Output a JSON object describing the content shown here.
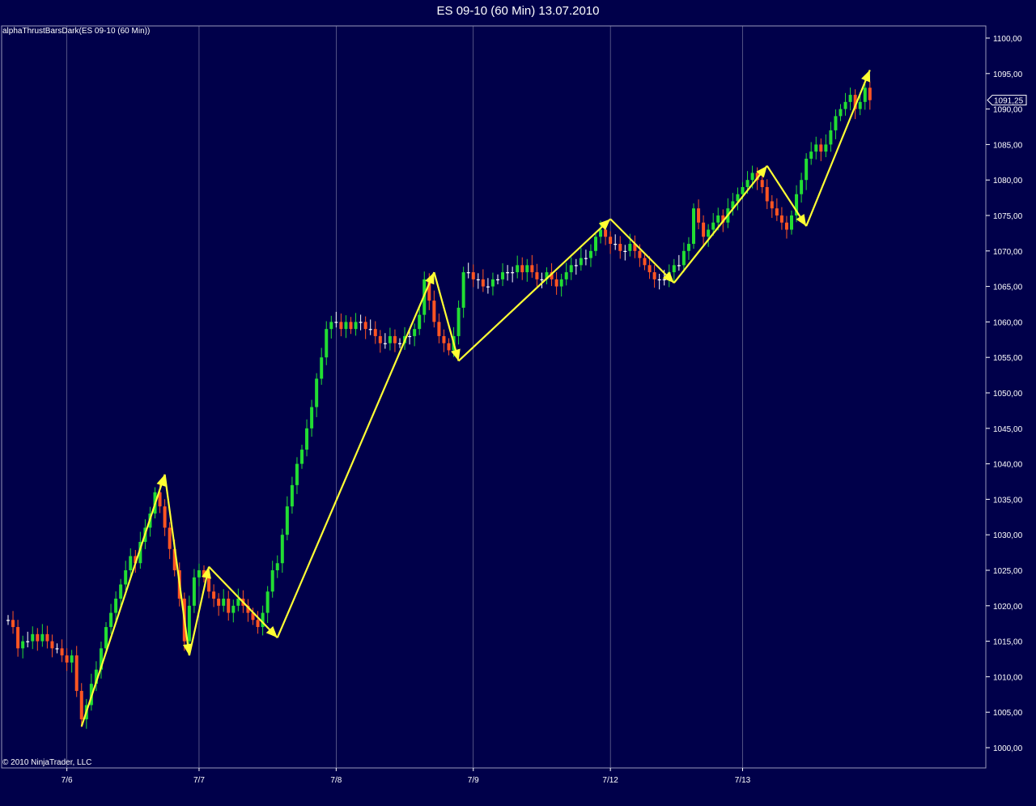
{
  "window": {
    "title": "ES 09-10 (60 Min)  13.07.2010",
    "indicator_label": "alphaThrustBarsDark(ES 09-10 (60 Min))",
    "copyright": "© 2010 NinjaTrader, LLC"
  },
  "colors": {
    "background": "#00004a",
    "grid": "#8888aa",
    "up_candle": "#22dd33",
    "down_candle": "#ff5522",
    "doji": "#ffffff",
    "zigzag": "#ffff33",
    "text": "#ffffff"
  },
  "chart_data": {
    "type": "candlestick",
    "title": "ES 09-10 (60 Min)  13.07.2010",
    "xlabel": "",
    "ylabel": "",
    "ylim": [
      998,
      1102
    ],
    "y_ticks": [
      1000,
      1005,
      1010,
      1015,
      1020,
      1025,
      1030,
      1035,
      1040,
      1045,
      1050,
      1055,
      1060,
      1065,
      1070,
      1075,
      1080,
      1085,
      1090,
      1095,
      1100
    ],
    "y_tick_labels": [
      "1000,00",
      "1005,00",
      "1010,00",
      "1015,00",
      "1020,00",
      "1025,00",
      "1030,00",
      "1035,00",
      "1040,00",
      "1045,00",
      "1050,00",
      "1055,00",
      "1060,00",
      "1065,00",
      "1070,00",
      "1075,00",
      "1080,00",
      "1085,00",
      "1090,00",
      "1095,00",
      "1100,00"
    ],
    "x_ticks": [
      {
        "label": "7/6",
        "bar": 12
      },
      {
        "label": "7/7",
        "bar": 39
      },
      {
        "label": "7/8",
        "bar": 67
      },
      {
        "label": "7/9",
        "bar": 95
      },
      {
        "label": "7/12",
        "bar": 123
      },
      {
        "label": "7/13",
        "bar": 150
      }
    ],
    "last_price": 1091.25,
    "last_price_label": "1091,25",
    "grid": "vertical-session-lines",
    "legend": "none",
    "closes": [
      1018,
      1017,
      1014,
      1015,
      1015,
      1016,
      1015,
      1016,
      1015,
      1014,
      1014,
      1013,
      1012,
      1013,
      1008,
      1004,
      1006,
      1009,
      1011,
      1014,
      1017,
      1019,
      1021,
      1023,
      1025,
      1027,
      1026,
      1029,
      1031,
      1033,
      1036,
      1034,
      1031,
      1028,
      1025,
      1021,
      1015,
      1020,
      1024,
      1025,
      1024,
      1022,
      1021,
      1020,
      1021,
      1019,
      1020,
      1021,
      1020,
      1019,
      1018,
      1017,
      1019,
      1022,
      1025,
      1026,
      1030,
      1034,
      1037,
      1040,
      1042,
      1045,
      1048,
      1052,
      1055,
      1059,
      1060,
      1060,
      1059,
      1060,
      1059,
      1060,
      1060,
      1059,
      1059,
      1058,
      1057,
      1057,
      1058,
      1057,
      1057,
      1058,
      1058,
      1059,
      1061,
      1066,
      1063,
      1060,
      1058,
      1057,
      1056,
      1058,
      1062,
      1067,
      1067,
      1066,
      1066,
      1065,
      1065,
      1066,
      1066,
      1067,
      1067,
      1067,
      1068,
      1067,
      1068,
      1067,
      1066,
      1066,
      1067,
      1066,
      1065,
      1066,
      1067,
      1068,
      1068,
      1069,
      1069,
      1070,
      1072,
      1073,
      1072,
      1071,
      1071,
      1070,
      1070,
      1071,
      1070,
      1069,
      1068,
      1067,
      1066,
      1066,
      1066,
      1067,
      1068,
      1068,
      1070,
      1071,
      1076,
      1074,
      1072,
      1073,
      1074,
      1075,
      1074,
      1076,
      1077,
      1078,
      1079,
      1080,
      1081,
      1080,
      1079,
      1077,
      1076,
      1075,
      1074,
      1073,
      1075,
      1078,
      1080,
      1083,
      1084,
      1085,
      1084,
      1085,
      1087,
      1089,
      1090,
      1091,
      1092,
      1090,
      1091,
      1093,
      1091.25
    ],
    "zigzag": [
      {
        "bar": 15,
        "price": 1003
      },
      {
        "bar": 32,
        "price": 1038.5
      },
      {
        "bar": 37,
        "price": 1013
      },
      {
        "bar": 41,
        "price": 1025.5
      },
      {
        "bar": 55,
        "price": 1015.5
      },
      {
        "bar": 87,
        "price": 1067
      },
      {
        "bar": 92,
        "price": 1054.5
      },
      {
        "bar": 123,
        "price": 1074.5
      },
      {
        "bar": 136,
        "price": 1065.5
      },
      {
        "bar": 155,
        "price": 1082
      },
      {
        "bar": 163,
        "price": 1073.5
      },
      {
        "bar": 176,
        "price": 1095.5
      }
    ]
  }
}
